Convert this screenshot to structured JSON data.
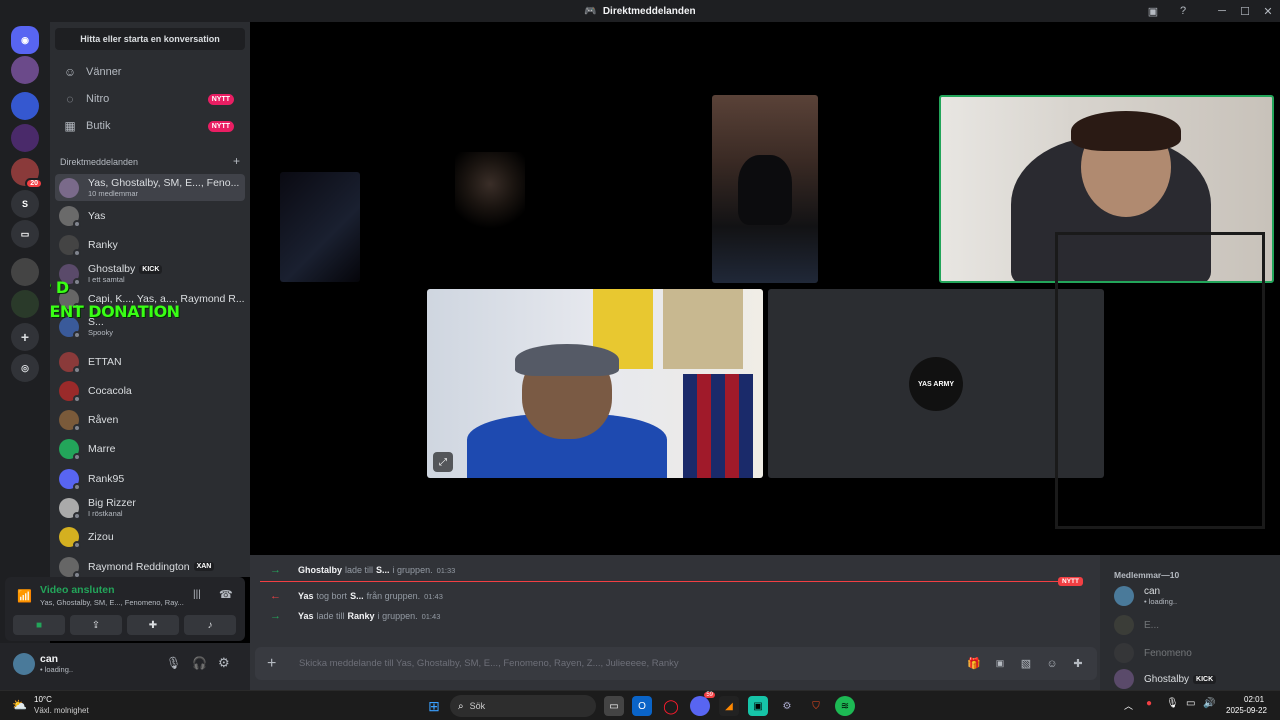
{
  "window": {
    "title": "Direktmeddelanden"
  },
  "sidebar": {
    "find_button": "Hitta eller starta en konversation",
    "nav": [
      {
        "label": "Vänner",
        "icon": "friends-icon"
      },
      {
        "label": "Nitro",
        "icon": "nitro-icon",
        "badge": "NYTT"
      },
      {
        "label": "Butik",
        "icon": "shop-icon",
        "badge": "NYTT"
      }
    ],
    "dm_header": "Direktmeddelanden",
    "dm_add": "+",
    "dms": [
      {
        "name": "Yas, Ghostalby, SM, E..., Feno...",
        "sub": "10 medlemmar",
        "color": "#7a6a8a"
      },
      {
        "name": "Yas",
        "sub": "",
        "color": "#6a6a6a"
      },
      {
        "name": "Ranky",
        "sub": "",
        "color": "#444"
      },
      {
        "name": "Ghostalby",
        "sub": "I ett samtal",
        "tag": "KICK",
        "color": "#5a4a6a"
      },
      {
        "name": "Capi, K..., Yas, a..., Raymond R...",
        "sub": "",
        "color": "#666"
      },
      {
        "name": "S...",
        "sub": "Spooky",
        "color": "#3a5a9a"
      },
      {
        "name": "ETTAN",
        "sub": "",
        "color": "#8a3a3a"
      },
      {
        "name": "Cocacola",
        "sub": "",
        "color": "#9a2a2a"
      },
      {
        "name": "Råven",
        "sub": "",
        "color": "#7a5a3a"
      },
      {
        "name": "Marre",
        "sub": "",
        "color": "#23a55a"
      },
      {
        "name": "Rank95",
        "sub": "",
        "color": "#5865f2"
      },
      {
        "name": "Big Rizzer",
        "sub": "I röstkanal",
        "color": "#aaa"
      },
      {
        "name": "Zizou",
        "sub": "",
        "color": "#d4b020"
      },
      {
        "name": "Raymond Reddington",
        "sub": "",
        "tag": "XAN",
        "color": "#666"
      }
    ]
  },
  "overlay": {
    "line1": "TOP D",
    "line2": "RECENT DONATION"
  },
  "voice": {
    "title": "Video ansluten",
    "sub": "Yas, Ghostalby, SM, E..., Fenomeno, Ray..."
  },
  "user": {
    "name": "can",
    "status": "• loading.."
  },
  "servers": [
    {
      "label": "",
      "badge": "20"
    },
    {
      "label": "S"
    }
  ],
  "chat": {
    "messages": [
      {
        "actor": "Ghostalby",
        "verb": "lade till",
        "target": "S...",
        "tail": "i gruppen.",
        "time": "01:33",
        "dir": "in"
      },
      {
        "actor": "Yas",
        "verb": "tog bort",
        "target": "S...",
        "tail": "från gruppen.",
        "time": "01:43",
        "dir": "out"
      },
      {
        "actor": "Yas",
        "verb": "lade till",
        "target": "Ranky",
        "tail": "i gruppen.",
        "time": "01:43",
        "dir": "in"
      }
    ],
    "new_label": "NYTT",
    "composer_placeholder": "Skicka meddelande till Yas, Ghostalby, SM, E..., Fenomeno, Rayen, Z..., Julieeeee, Ranky"
  },
  "members": {
    "header": "Medlemmar—10",
    "list": [
      {
        "name": "can",
        "sub": "• loading..",
        "color": "#4a7a9a"
      },
      {
        "name": "E...",
        "sub": "",
        "color": "#554"
      },
      {
        "name": "Fenomeno",
        "sub": "",
        "color": "#444"
      },
      {
        "name": "Ghostalby",
        "sub": "",
        "tag": "KICK",
        "color": "#5a4a6a"
      }
    ]
  },
  "video": {
    "avatar_text": "YAS ARMY"
  },
  "taskbar": {
    "weather_temp": "10°C",
    "weather_desc": "Växl. molnighet",
    "search": "Sök",
    "time": "02:01",
    "date": "2025-09-22",
    "discord_badge": "59"
  }
}
